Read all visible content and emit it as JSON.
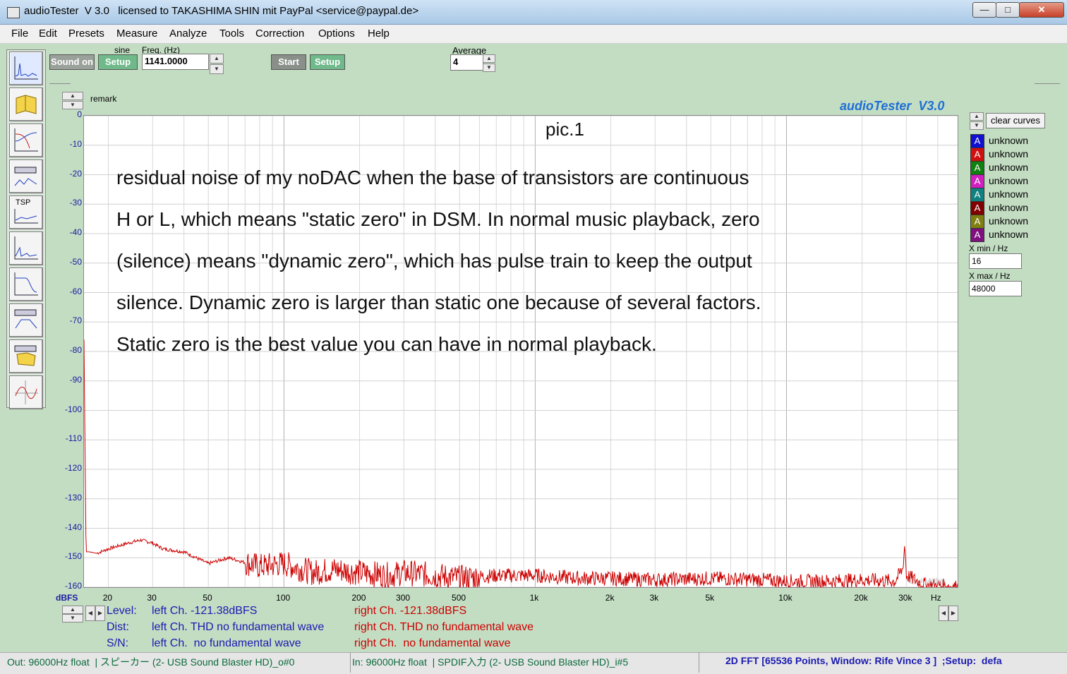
{
  "window": {
    "title": "audioTester  V 3.0   licensed to TAKASHIMA SHIN mit PayPal <service@paypal.de>",
    "minimize": "—",
    "maximize": "□",
    "close": "✕"
  },
  "menu": [
    "File",
    "Edit",
    "Presets",
    "Measure",
    "Analyze",
    "Tools",
    "Correction",
    "Options",
    "Help"
  ],
  "toolbar": {
    "sound_button": "Sound on",
    "sine_label": "sine",
    "setup1": "Setup",
    "freq_label": "Freq. (Hz)",
    "freq_value": "1141.0000",
    "start": "Start",
    "setup2": "Setup",
    "average_label": "Average",
    "average_value": "4",
    "remark_label": "remark"
  },
  "left_tools": [
    "fft-icon",
    "book-icon",
    "bode-icon",
    "generator-icon",
    "tsp-icon",
    "spectrum-icon",
    "filter-icon",
    "eq-icon",
    "mixer-icon",
    "scope-icon"
  ],
  "left_tsp_text": "TSP",
  "plot": {
    "brand": "audioTester  V3.0",
    "title": "pic.1",
    "annotation": [
      "residual noise of my noDAC when the base of transistors are continuous",
      "H or L, which means \"static zero\" in DSM. In normal music playback, zero",
      "(silence) means \"dynamic zero\", which has pulse train to keep the output",
      "silence. Dynamic zero is larger than static one because of several factors.",
      "Static zero is the best value you can have in normal playback."
    ],
    "copyright": "© U.Müller",
    "y_unit": "dBFS",
    "x_unit": "Hz"
  },
  "chart_data": {
    "type": "line",
    "title": "pic.1",
    "xlabel": "Hz",
    "ylabel": "dBFS",
    "x_scale": "log",
    "xlim": [
      16,
      48000
    ],
    "ylim": [
      -160,
      0
    ],
    "y_ticks": [
      0,
      -10,
      -20,
      -30,
      -40,
      -50,
      -60,
      -70,
      -80,
      -90,
      -100,
      -110,
      -120,
      -130,
      -140,
      -150,
      -160
    ],
    "x_tick_labels": [
      "20",
      "30",
      "50",
      "100",
      "200",
      "300",
      "500",
      "1k",
      "2k",
      "3k",
      "5k",
      "10k",
      "20k",
      "30k"
    ],
    "x_tick_values": [
      20,
      30,
      50,
      100,
      200,
      300,
      500,
      1000,
      2000,
      3000,
      5000,
      10000,
      20000,
      30000
    ],
    "grid": true,
    "series": [
      {
        "color": "#cc0000",
        "x": [
          16,
          16.3,
          16.8,
          18,
          20,
          24,
          27,
          30,
          33,
          40,
          50,
          60,
          80,
          100,
          130,
          160,
          200,
          260,
          300,
          400,
          500,
          700,
          1000,
          1500,
          2000,
          3000,
          5000,
          8000,
          10000,
          15000,
          20000,
          27000,
          29000,
          29600,
          30000,
          35000,
          48000
        ],
        "y": [
          -76,
          -148,
          -148,
          -148.5,
          -147,
          -145,
          -144,
          -145,
          -147,
          -148,
          -152,
          -150,
          -153,
          -152,
          -155,
          -154,
          -155,
          -156,
          -155,
          -156,
          -157,
          -156,
          -156,
          -157,
          -157,
          -157.5,
          -157,
          -157.5,
          -158,
          -158,
          -157.5,
          -158,
          -154,
          -145,
          -156,
          -159,
          -160
        ]
      }
    ]
  },
  "legend": {
    "clear": "clear curves",
    "swatch_text": "A",
    "items": [
      {
        "label": "unknown",
        "color": "#1010d0"
      },
      {
        "label": "unknown",
        "color": "#d01010"
      },
      {
        "label": "unknown",
        "color": "#108010"
      },
      {
        "label": "unknown",
        "color": "#d020c0"
      },
      {
        "label": "unknown",
        "color": "#108080"
      },
      {
        "label": "unknown",
        "color": "#800000"
      },
      {
        "label": "unknown",
        "color": "#808010"
      },
      {
        "label": "unknown",
        "color": "#801080"
      }
    ],
    "xmin_label": "X min / Hz",
    "xmin_value": "16",
    "xmax_label": "X max / Hz",
    "xmax_value": "48000"
  },
  "readouts": {
    "level_label": "Level:",
    "level_left": "left Ch. -121.38dBFS",
    "level_right": "right Ch. -121.38dBFS",
    "dist_label": "Dist:",
    "dist_left": "left Ch. THD no fundamental wave",
    "dist_right": "right Ch. THD no fundamental wave",
    "sn_label": "S/N:",
    "sn_left": "left Ch.  no fundamental wave",
    "sn_right": "right Ch.  no fundamental wave"
  },
  "status": {
    "out": "Out: 96000Hz float  | スピーカー (2- USB Sound Blaster HD)_o#0",
    "in": "In: 96000Hz float  | SPDIF入力 (2- USB Sound Blaster HD)_i#5",
    "fft": "2D FFT [65536 Points, Window: Rife Vince 3 ]  ;Setup:  defa"
  },
  "colors": {
    "left": "#1a1ab0",
    "right": "#cc0000",
    "brand": "#1f6fd6",
    "background": "#c3ddc3"
  }
}
